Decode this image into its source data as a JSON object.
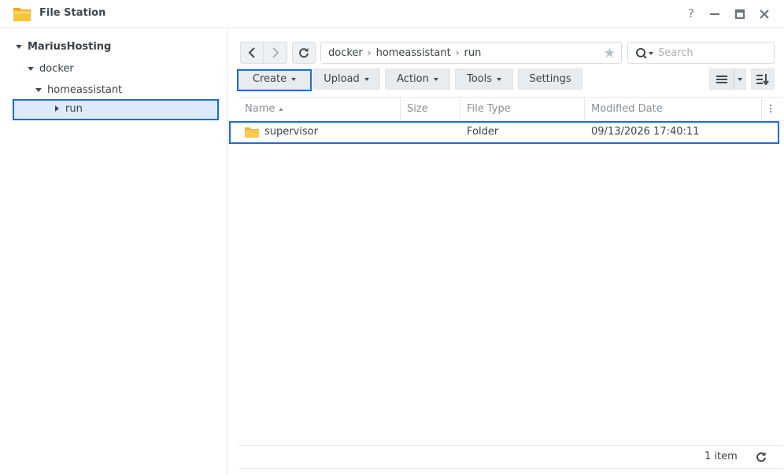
{
  "window": {
    "title": "File Station",
    "help_icon": "help-icon",
    "minimize_icon": "minimize-icon",
    "maximize_icon": "maximize-icon",
    "close_icon": "close-icon"
  },
  "tree": {
    "root": "MariusHosting",
    "items": [
      {
        "label": "docker"
      },
      {
        "label": "homeassistant"
      },
      {
        "label": "run"
      }
    ]
  },
  "path": {
    "crumbs": [
      "docker",
      "homeassistant",
      "run"
    ]
  },
  "search": {
    "placeholder": "Search"
  },
  "toolbar": {
    "create": "Create",
    "upload": "Upload",
    "action": "Action",
    "tools": "Tools",
    "settings": "Settings"
  },
  "table": {
    "headers": [
      "Name",
      "Size",
      "File Type",
      "Modified Date"
    ],
    "rows": [
      {
        "name": "supervisor",
        "size": "",
        "type": "Folder",
        "modified": "09/13/2026 17:40:11"
      }
    ]
  },
  "footer": {
    "count": "1 item"
  },
  "colors": {
    "accent": "#1a6cde",
    "selected_bg": "#dcebfb",
    "folder": "#f5b82e"
  }
}
